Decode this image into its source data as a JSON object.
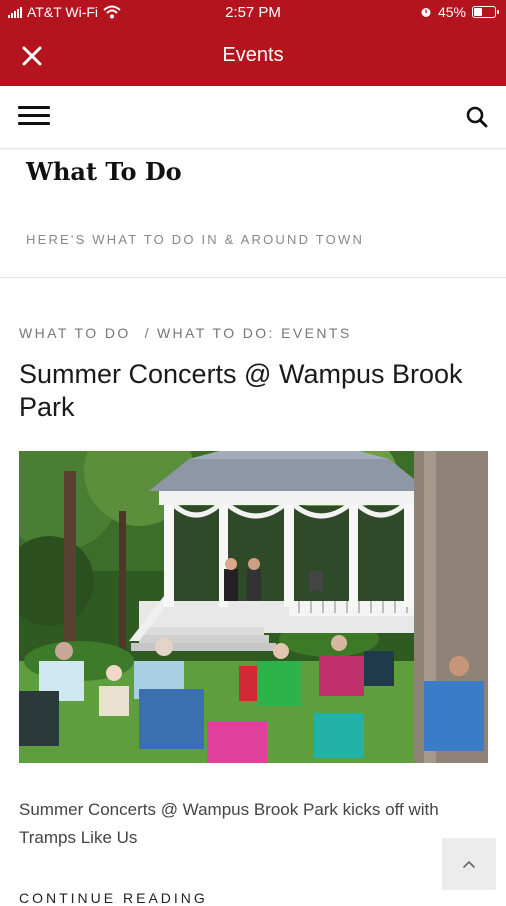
{
  "status_bar": {
    "carrier": "AT&T Wi-Fi",
    "time": "2:57 PM",
    "battery_percent": "45%",
    "battery_level": 0.45,
    "icons": [
      "signal-icon",
      "wifi-icon",
      "alarm-icon",
      "battery-icon"
    ]
  },
  "app_bar": {
    "title": "Events",
    "close_icon": "close-icon",
    "background": "#b4141e"
  },
  "nav": {
    "menu_icon": "hamburger-menu-icon",
    "search_icon": "search-icon"
  },
  "site": {
    "title": "What To Do",
    "tagline": "HERE'S WHAT TO DO IN & AROUND TOWN"
  },
  "post": {
    "breadcrumb": [
      "WHAT TO DO",
      "WHAT TO DO: EVENTS"
    ],
    "breadcrumb_separator": "/",
    "title": "Summer Concerts @ Wampus Brook Park",
    "excerpt": "Summer Concerts @ Wampus Brook Park kicks off with Tramps Like Us",
    "continue_label": "CONTINUE READING"
  },
  "back_to_top": {
    "icon": "chevron-up-icon"
  }
}
